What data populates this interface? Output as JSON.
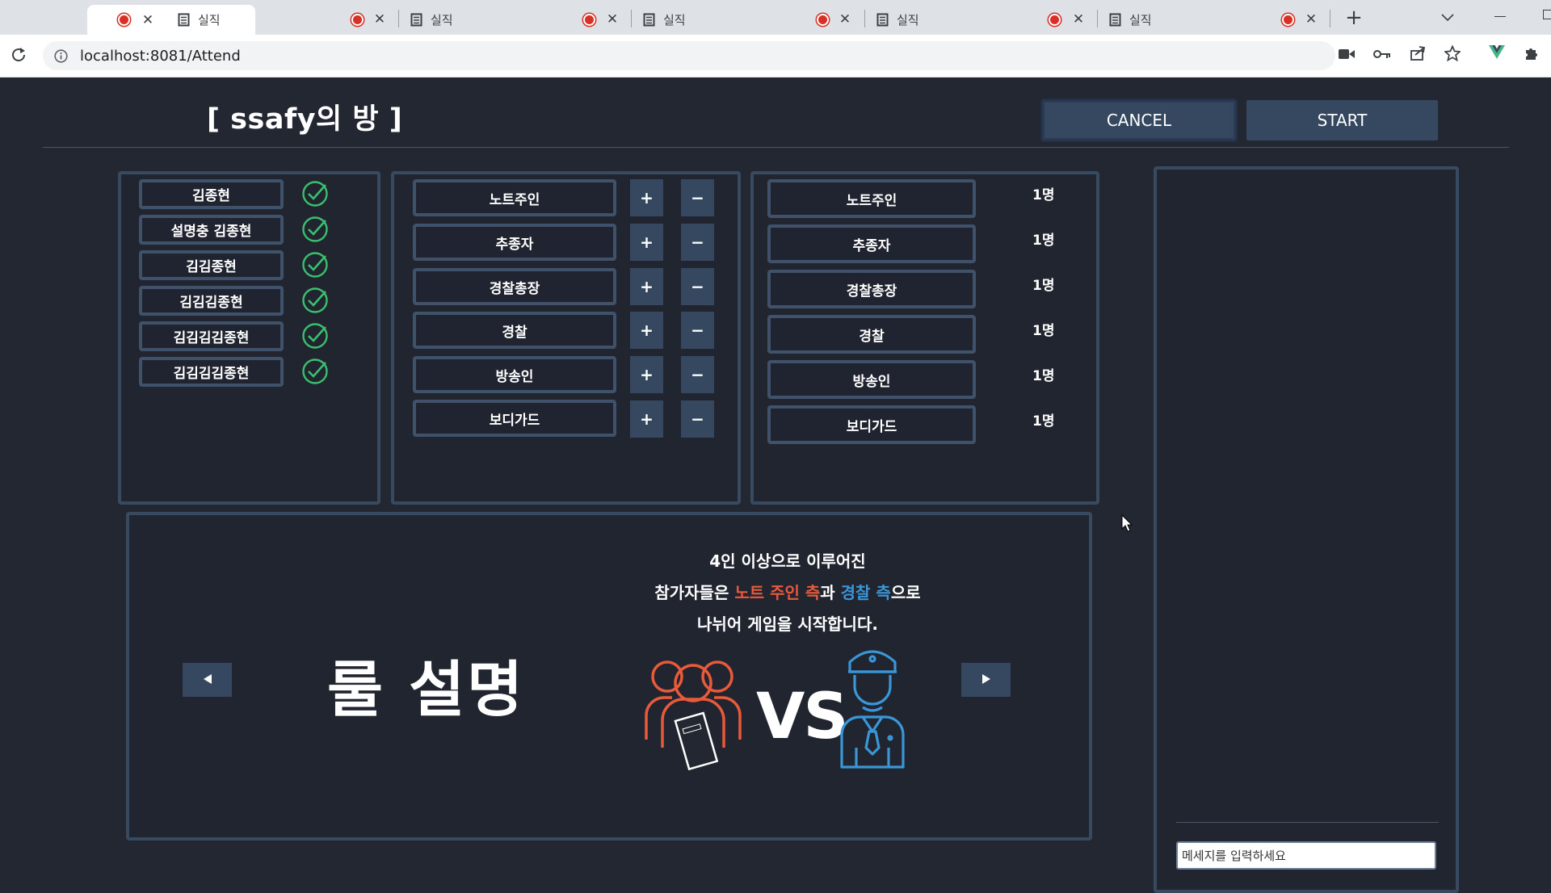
{
  "browser": {
    "tabs": [
      {
        "title": "",
        "active": true
      },
      {
        "title": "실직"
      },
      {
        "title": "실직"
      },
      {
        "title": "실직"
      },
      {
        "title": "실직"
      },
      {
        "title": "실직"
      }
    ],
    "url": "localhost:8081/Attend"
  },
  "room": {
    "title": "[ ssafy의 방 ]",
    "cancel_label": "CANCEL",
    "start_label": "START"
  },
  "players": [
    {
      "name": "김종현",
      "ready": true
    },
    {
      "name": "설명충 김종현",
      "ready": true
    },
    {
      "name": "김김종현",
      "ready": true
    },
    {
      "name": "김김김종현",
      "ready": true
    },
    {
      "name": "김김김김종현",
      "ready": true
    },
    {
      "name": "김김김김종현",
      "ready": true
    }
  ],
  "roles": {
    "plus_label": "+",
    "minus_label": "−",
    "items": [
      "노트주인",
      "추종자",
      "경찰총장",
      "경찰",
      "방송인",
      "보디가드"
    ]
  },
  "summary": [
    {
      "role": "노트주인",
      "count": "1명"
    },
    {
      "role": "추종자",
      "count": "1명"
    },
    {
      "role": "경찰총장",
      "count": "1명"
    },
    {
      "role": "경찰",
      "count": "1명"
    },
    {
      "role": "방송인",
      "count": "1명"
    },
    {
      "role": "보디가드",
      "count": "1명"
    }
  ],
  "rules": {
    "title": "룰 설명",
    "line1": "4인 이상으로 이루어진",
    "line2_pre": "참가자들은 ",
    "line2_red": "노트 주인 측",
    "line2_mid": "과 ",
    "line2_blue": "경찰 측",
    "line2_post": "으로",
    "line3": "나뉘어 게임을 시작합니다.",
    "vs": "VS",
    "colors": {
      "note_side": "#e85a3a",
      "police_side": "#3b96d8"
    }
  },
  "chat": {
    "placeholder": "메세지를 입력하세요"
  }
}
